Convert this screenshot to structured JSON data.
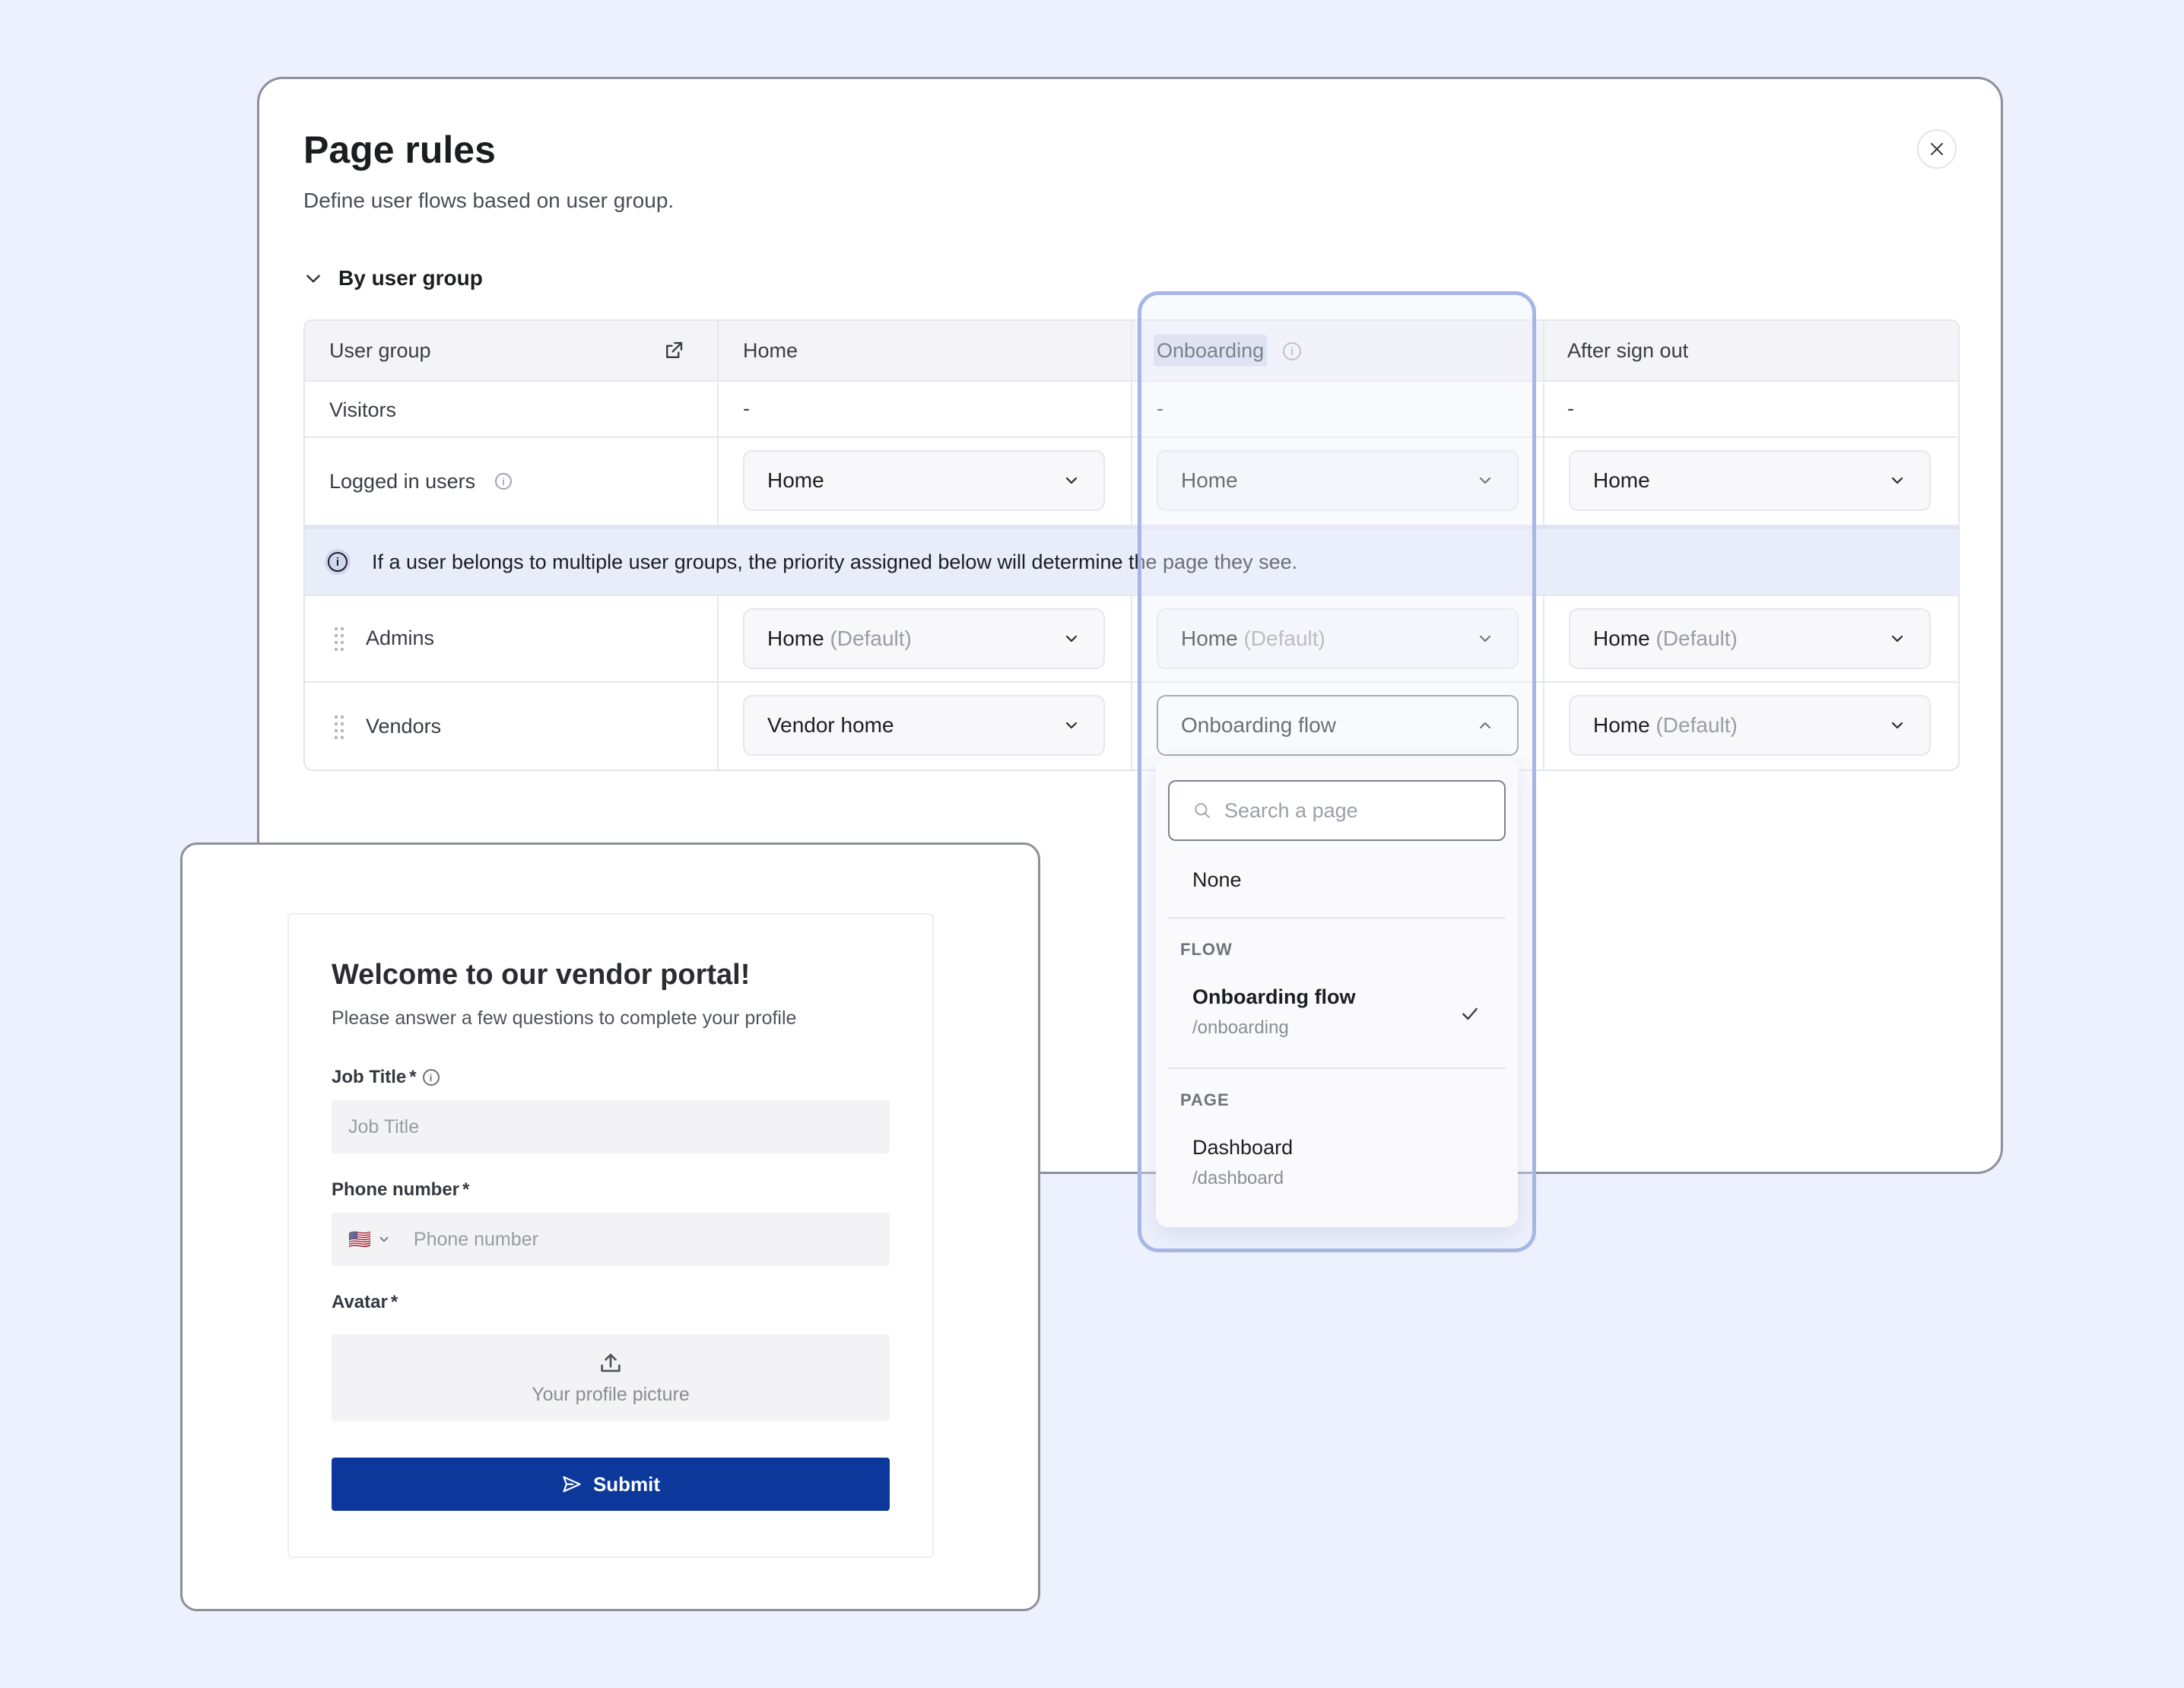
{
  "modal": {
    "title": "Page rules",
    "subtitle": "Define user flows based on user group.",
    "section_label": "By user group"
  },
  "table": {
    "headers": {
      "user_group": "User group",
      "home": "Home",
      "onboarding": "Onboarding",
      "after_sign_out": "After sign out"
    },
    "visitors": {
      "label": "Visitors",
      "home": "-",
      "onboarding": "-",
      "after_sign_out": "-"
    },
    "logged_in": {
      "label": "Logged in users",
      "home": "Home",
      "onboarding": "Home",
      "after_sign_out": "Home"
    },
    "banner_text": "If a user belongs to multiple user groups, the priority assigned below will determine the page they see.",
    "admins": {
      "label": "Admins",
      "home": "Home",
      "onboarding": "Home",
      "after_sign_out": "Home",
      "default_tag": "(Default)"
    },
    "vendors": {
      "label": "Vendors",
      "home": "Vendor home",
      "onboarding": "Onboarding flow",
      "after_sign_out": "Home",
      "default_tag": "(Default)"
    }
  },
  "dropdown": {
    "search_placeholder": "Search a page",
    "none_label": "None",
    "flow_group": "FLOW",
    "flow_item": {
      "title": "Onboarding flow",
      "path": "/onboarding",
      "selected": true
    },
    "page_group": "PAGE",
    "page_item": {
      "title": "Dashboard",
      "path": "/dashboard"
    }
  },
  "vendor_form": {
    "title": "Welcome to our vendor portal!",
    "subtitle": "Please answer a few questions to complete your profile",
    "job_title_label": "Job Title",
    "job_title_placeholder": "Job Title",
    "phone_label": "Phone number",
    "phone_placeholder": "Phone number",
    "flag": "🇺🇸",
    "avatar_label": "Avatar",
    "avatar_placeholder": "Your profile picture",
    "required_mark": "*",
    "submit_label": "Submit"
  },
  "colors": {
    "background": "#edf0fd",
    "submit": "#0c389b",
    "highlight": "#a6b6e6",
    "banner": "#e9edfa"
  }
}
